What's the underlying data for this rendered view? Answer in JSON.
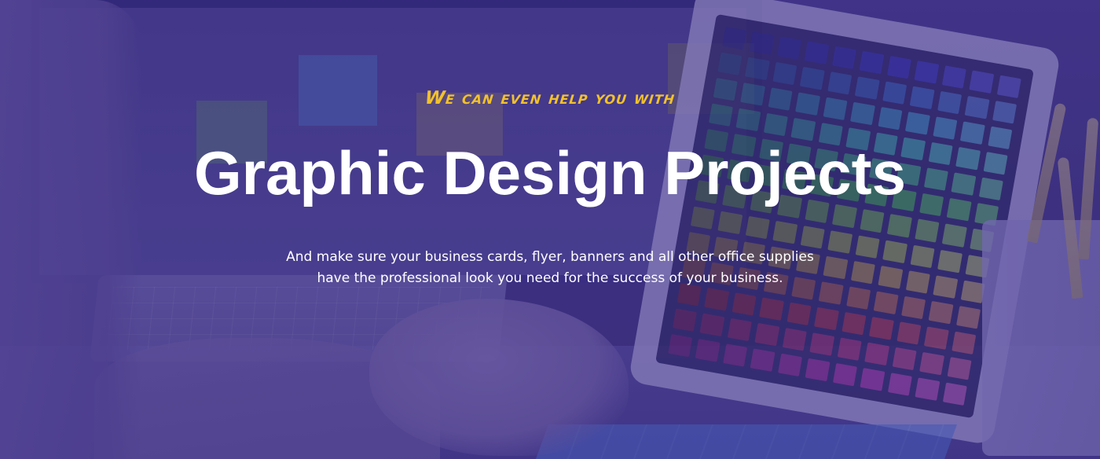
{
  "hero": {
    "eyebrow": "We can even help you with",
    "title": "Graphic Design Projects",
    "description_line1": "And make sure your business cards, flyer, banners and all other office supplies",
    "description_line2": "have the professional look you need for the success of your business."
  },
  "colors": {
    "eyebrow": "#f2c12c",
    "title": "#ffffff",
    "overlay": "#3a2c84"
  }
}
